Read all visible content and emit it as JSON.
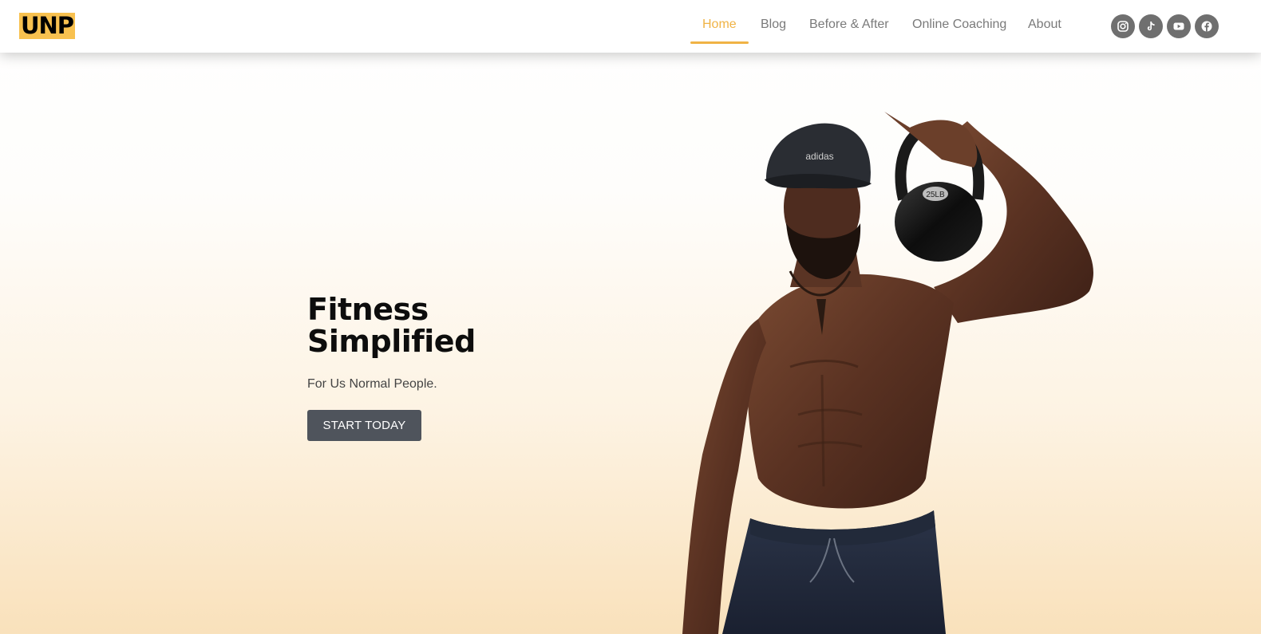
{
  "brand": {
    "logo_text": "UNP",
    "logo_bg": "#f8c14f"
  },
  "nav": {
    "items": [
      {
        "label": "Home",
        "active": true
      },
      {
        "label": "Blog",
        "active": false
      },
      {
        "label": "Before & After",
        "active": false
      },
      {
        "label": "Online Coaching",
        "active": false
      },
      {
        "label": "About",
        "active": false
      }
    ],
    "active_color": "#f0b345",
    "default_color": "#7a7a7a"
  },
  "social": [
    {
      "icon": "instagram-icon"
    },
    {
      "icon": "tiktok-icon"
    },
    {
      "icon": "youtube-icon"
    },
    {
      "icon": "facebook-icon"
    }
  ],
  "hero": {
    "title_line1": "Fitness",
    "title_line2": "Simplified",
    "subtitle": "For Us Normal People.",
    "cta_label": "START TODAY",
    "cta_color": "#4f545c"
  },
  "image": {
    "subject": "shirtless-man-with-kettlebell",
    "cap_text": "adidas",
    "kettlebell_label": "25LB"
  }
}
